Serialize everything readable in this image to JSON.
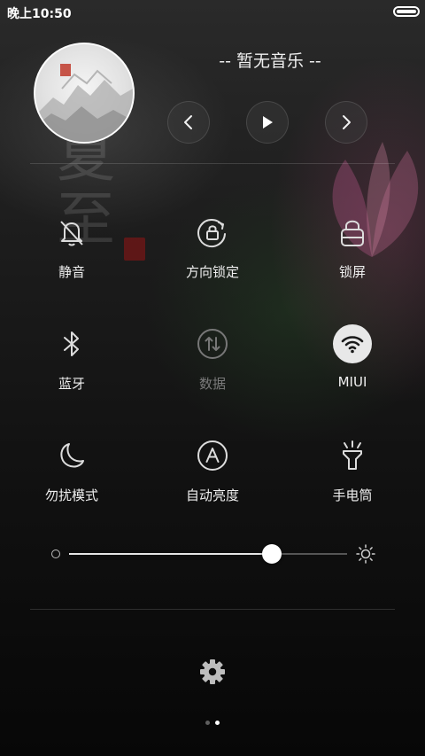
{
  "status_bar": {
    "time": "晚上10:50",
    "battery_level": 1.0
  },
  "music": {
    "title": "-- 暂无音乐 --",
    "prev_icon": "chevron-left-icon",
    "play_icon": "play-icon",
    "next_icon": "chevron-right-icon"
  },
  "toggles": [
    {
      "label": "静音",
      "icon": "bell-off-icon",
      "active": false,
      "enabled": true
    },
    {
      "label": "方向锁定",
      "icon": "rotation-lock-icon",
      "active": false,
      "enabled": true
    },
    {
      "label": "锁屏",
      "icon": "lock-icon",
      "active": false,
      "enabled": true
    },
    {
      "label": "蓝牙",
      "icon": "bluetooth-icon",
      "active": false,
      "enabled": true
    },
    {
      "label": "数据",
      "icon": "mobile-data-icon",
      "active": false,
      "enabled": false
    },
    {
      "label": "MIUI",
      "icon": "wifi-icon",
      "active": true,
      "enabled": true
    },
    {
      "label": "勿扰模式",
      "icon": "moon-icon",
      "active": false,
      "enabled": true
    },
    {
      "label": "自动亮度",
      "icon": "auto-brightness-icon",
      "active": false,
      "enabled": true
    },
    {
      "label": "手电筒",
      "icon": "flashlight-icon",
      "active": false,
      "enabled": true
    }
  ],
  "brightness": {
    "level": 0.73
  },
  "settings": {
    "icon": "gear-icon"
  },
  "pager": {
    "page_count": 2,
    "current_page": 2
  },
  "colors": {
    "active_toggle_bg": "#e8e8e8",
    "text": "#efefef",
    "disabled_text": "#7a7a7a"
  }
}
